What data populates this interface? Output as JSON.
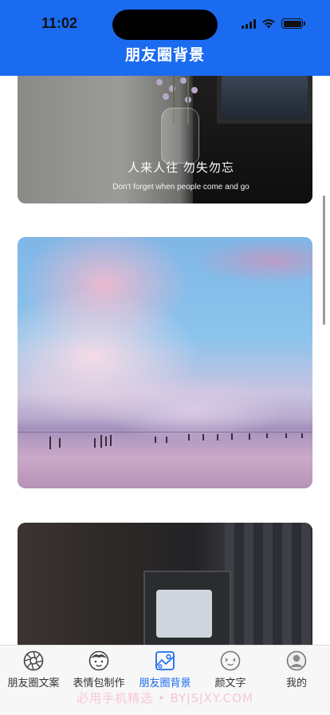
{
  "status_bar": {
    "time": "11:02"
  },
  "header": {
    "title": "朋友圈背景",
    "color": "#1a6bf0"
  },
  "feed": {
    "cards": [
      {
        "quote_cn": "人来人往 勿失勿忘",
        "quote_en": "Don't forget when people come and go"
      },
      {
        "quote_cn": "",
        "quote_en": ""
      },
      {
        "quote_cn": "",
        "quote_en": ""
      }
    ]
  },
  "tabbar": {
    "active_color": "#1a6bf0",
    "items": [
      {
        "label": "朋友圈文案",
        "icon": "aperture-icon",
        "active": false
      },
      {
        "label": "表情包制作",
        "icon": "face-icon",
        "active": false
      },
      {
        "label": "朋友圈背景",
        "icon": "image-icon",
        "active": true
      },
      {
        "label": "颜文字",
        "icon": "kaomoji-icon",
        "active": false
      },
      {
        "label": "我的",
        "icon": "profile-icon",
        "active": false
      }
    ]
  },
  "watermark": "必用手机精选 • BYJSJXY.COM"
}
